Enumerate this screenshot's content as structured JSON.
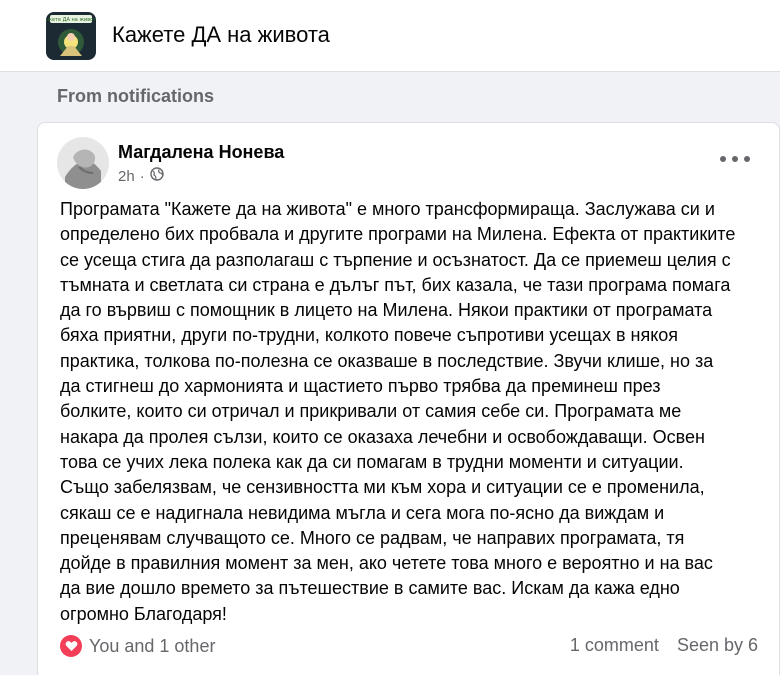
{
  "group": {
    "name": "Кажете ДА на живота",
    "logo_text": "Кажете ДА на живота!"
  },
  "context_label": "From notifications",
  "post": {
    "author": "Магдалена Нонева",
    "time": "2h",
    "privacy_icon": "public-globe-icon",
    "text": "Програмата \"Кажете да на живота\" е много трансформираща. Заслужава си и\nопределено бих пробвала и другите програми на Милена. Ефекта от практиките\nсе усеща стига да разполагаш с търпение и  осъзнатост. Да се приемеш  целия с\nтъмната и светлата си страна е дълъг път, бих казала, че тази програма помага\nда го вървиш с помощник в лицето на Милена. Някои практики от програмата\nбяха приятни, други по-трудни, колкото повече съпротиви усещах в някоя\nпрактика, толкова по-полезна се оказваше в последствие. Звучи клише, но за\nда стигнеш до хармонията и щастието първо трябва да преминеш през\nболките, които си отричал и прикривали от самия себе си. Програмата ме\nнакара да пролея сълзи, които се оказаха лечебни и освобождаващи. Освен\nтова се учих лека полека как да си помагам в трудни моменти и ситуации.\nСъщо забелязвам, че сензивността ми към хора и ситуации се е променила,\nсякаш се е надигнала невидима мъгла и сега мога по-ясно да виждам и\nпреценявам случващото се. Много се радвам, че направих програмата, тя\nдойде в правилния момент за мен, ако четете това много е вероятно и на вас\nда вие дошло времето за пътешествие в самите вас. Искам да кажа едно\nогромно Благодаря!",
    "reactions": "You and 1 other",
    "reaction_icon": "heart-icon",
    "comments": "1 comment",
    "seen_by": "Seen by 6"
  },
  "colors": {
    "background": "#f0f2f5",
    "card": "#ffffff",
    "secondary_text": "#65676b",
    "heart": "#f33e58"
  }
}
